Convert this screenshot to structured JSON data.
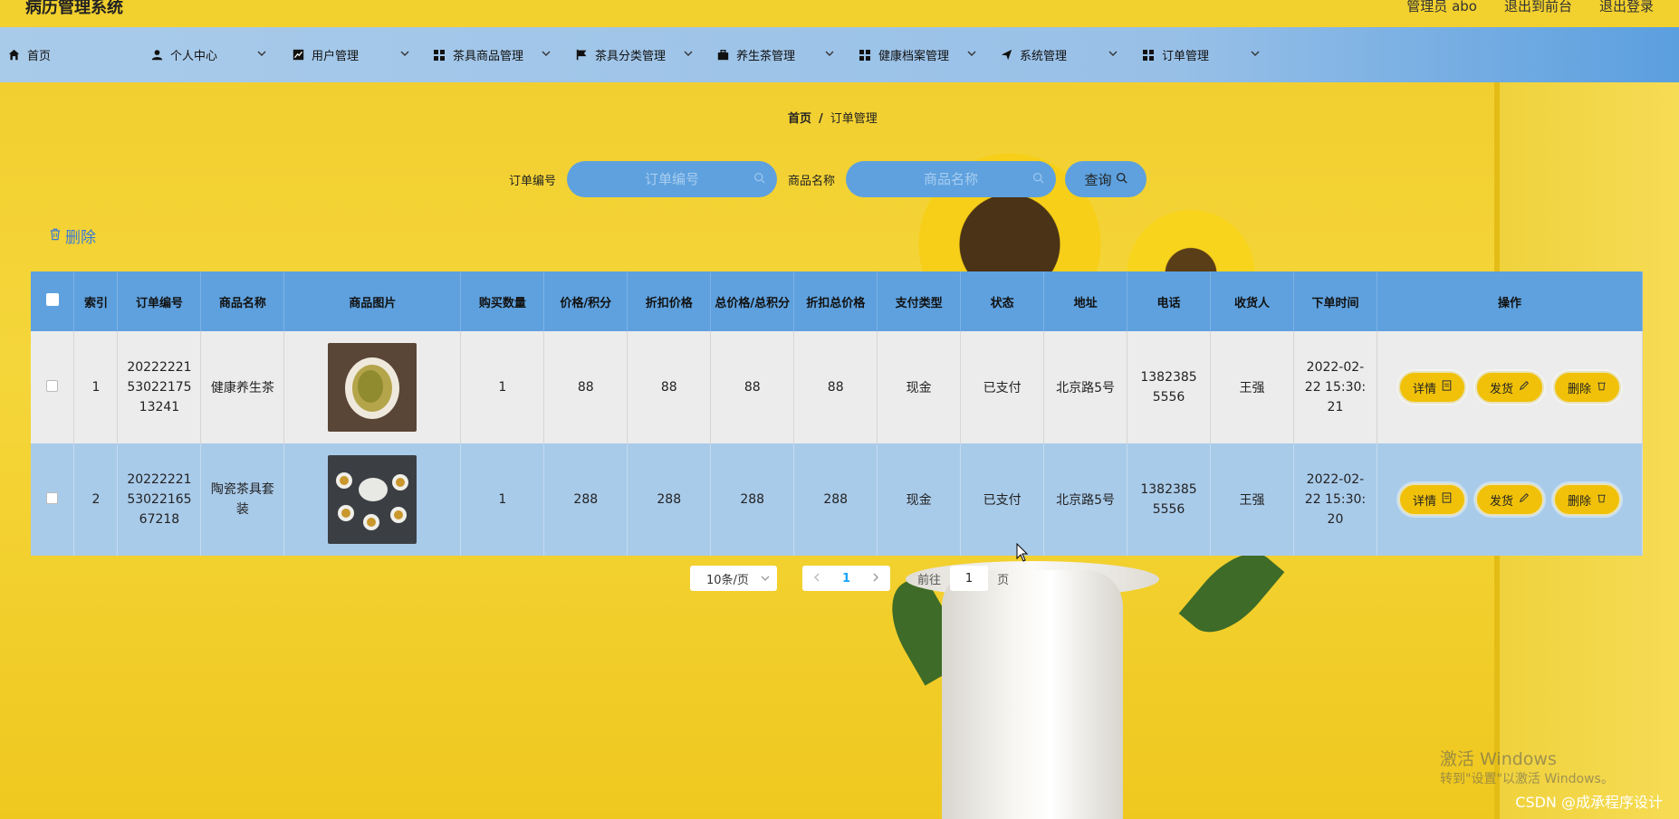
{
  "header": {
    "title": "病历管理系统",
    "admin_label": "管理员 abo",
    "back_front": "退出到前台",
    "logout": "退出登录"
  },
  "nav": {
    "home": "首页",
    "items": [
      {
        "label": "个人中心",
        "icon": "user-icon"
      },
      {
        "label": "用户管理",
        "icon": "chart-icon"
      },
      {
        "label": "茶具商品管理",
        "icon": "grid-icon"
      },
      {
        "label": "茶具分类管理",
        "icon": "flag-icon"
      },
      {
        "label": "养生茶管理",
        "icon": "briefcase-icon"
      },
      {
        "label": "健康档案管理",
        "icon": "grid-icon"
      },
      {
        "label": "系统管理",
        "icon": "send-icon"
      },
      {
        "label": "订单管理",
        "icon": "grid-icon"
      }
    ]
  },
  "breadcrumb": {
    "home": "首页",
    "sep": "/",
    "current": "订单管理"
  },
  "search": {
    "order_label": "订单编号",
    "order_placeholder": "订单编号",
    "product_label": "商品名称",
    "product_placeholder": "商品名称",
    "query": "查询"
  },
  "toolbar": {
    "delete": "删除"
  },
  "table": {
    "headers": [
      "索引",
      "订单编号",
      "商品名称",
      "商品图片",
      "购买数量",
      "价格/积分",
      "折扣价格",
      "总价格/总积分",
      "折扣总价格",
      "支付类型",
      "状态",
      "地址",
      "电话",
      "收货人",
      "下单时间",
      "操作"
    ],
    "rows": [
      {
        "index": "1",
        "order_no": "2022222153022175 13241",
        "name": "健康养生茶",
        "qty": "1",
        "price": "88",
        "discount": "88",
        "total": "88",
        "discount_total": "88",
        "pay": "现金",
        "status": "已支付",
        "address": "北京路5号",
        "phone": "13823855556",
        "receiver": "王强",
        "time": "2022-02-22 15:30:21"
      },
      {
        "index": "2",
        "order_no": "2022222153022165 67218",
        "name": "陶瓷茶具套装",
        "qty": "1",
        "price": "288",
        "discount": "288",
        "total": "288",
        "discount_total": "288",
        "pay": "现金",
        "status": "已支付",
        "address": "北京路5号",
        "phone": "13823855556",
        "receiver": "王强",
        "time": "2022-02-22 15:30:20"
      }
    ],
    "ops": {
      "detail": "详情",
      "ship": "发货",
      "delete": "删除"
    }
  },
  "pagination": {
    "page_size": "10条/页",
    "current": "1",
    "goto": "前往",
    "goto_value": "1",
    "page_unit": "页"
  },
  "watermark": {
    "line1": "激活 Windows",
    "line2": "转到\"设置\"以激活 Windows。",
    "csdn": "CSDN @成承程序设计"
  },
  "colors": {
    "nav": "#98c0e7",
    "header_bg": "#5ea1de",
    "op_btn": "#f0c108",
    "background": "#f3cf2c"
  }
}
